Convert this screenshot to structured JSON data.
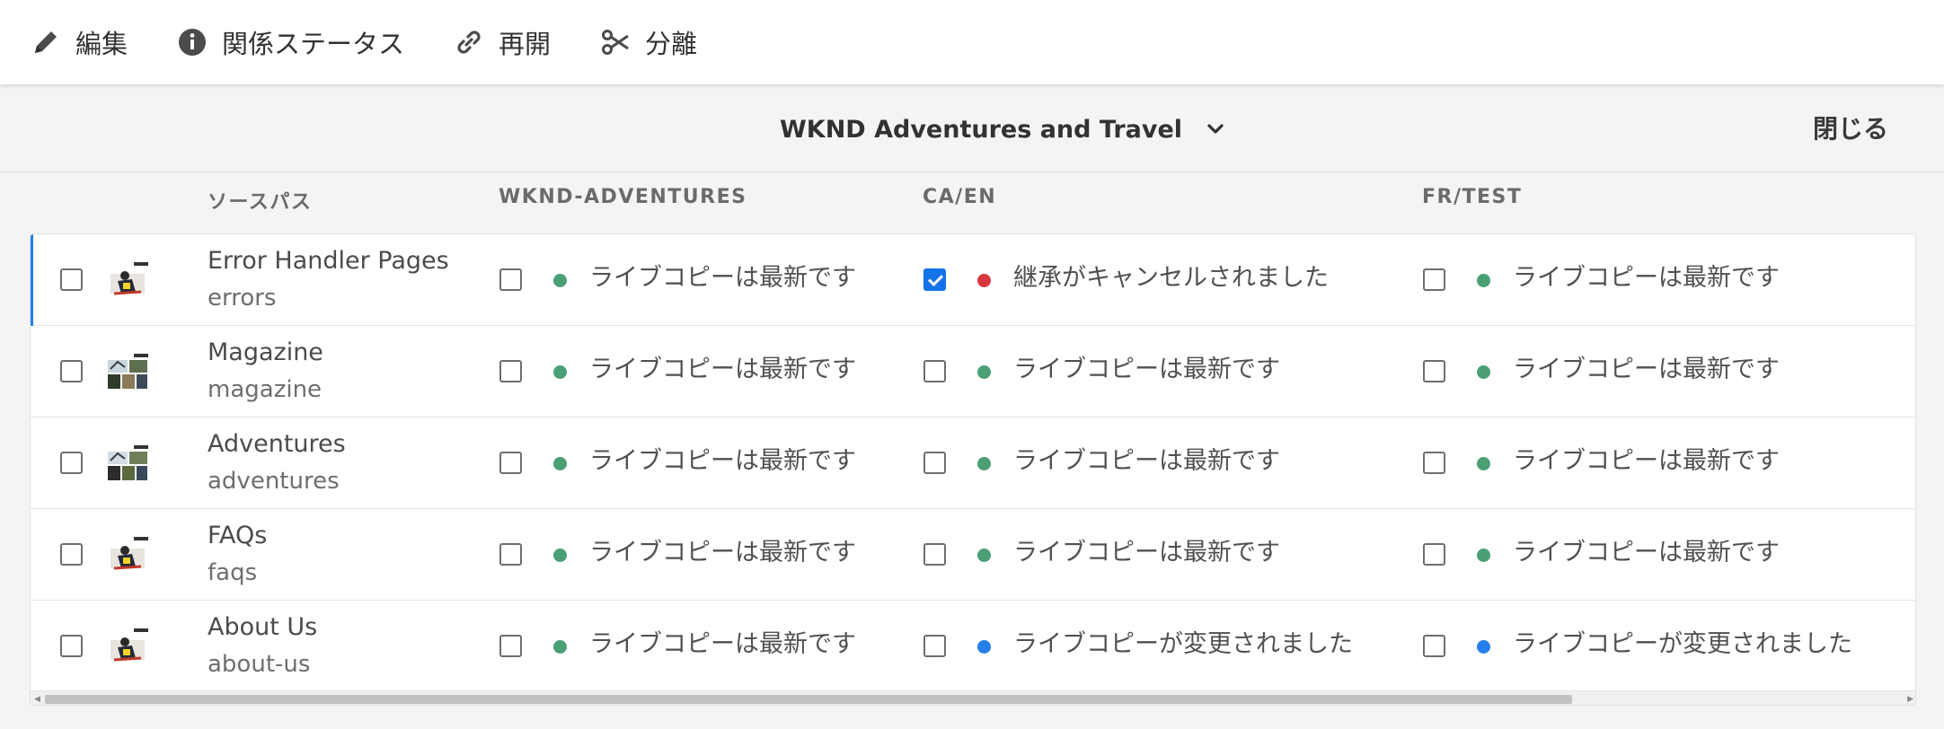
{
  "toolbar": {
    "edit_label": "編集",
    "status_label": "関係ステータス",
    "resume_label": "再開",
    "detach_label": "分離"
  },
  "header": {
    "site_name": "WKND Adventures and Travel",
    "close_label": "閉じる"
  },
  "columns": {
    "source": "ソースパス",
    "c1": "WKND-ADVENTURES",
    "c2": "CA/EN",
    "c3": "FR/TEST"
  },
  "status_colors": {
    "up_to_date": "#4a9f75",
    "cancelled": "#d7373f",
    "modified": "#2680eb"
  },
  "rows": [
    {
      "title": "Error Handler Pages",
      "path": "errors",
      "selected": true,
      "cells": [
        {
          "checked": false,
          "status": "up_to_date",
          "text": "ライブコピーは最新です"
        },
        {
          "checked": true,
          "status": "cancelled",
          "text": "継承がキャンセルされました"
        },
        {
          "checked": false,
          "status": "up_to_date",
          "text": "ライブコピーは最新です"
        }
      ]
    },
    {
      "title": "Magazine",
      "path": "magazine",
      "selected": false,
      "cells": [
        {
          "checked": false,
          "status": "up_to_date",
          "text": "ライブコピーは最新です"
        },
        {
          "checked": false,
          "status": "up_to_date",
          "text": "ライブコピーは最新です"
        },
        {
          "checked": false,
          "status": "up_to_date",
          "text": "ライブコピーは最新です"
        }
      ]
    },
    {
      "title": "Adventures",
      "path": "adventures",
      "selected": false,
      "cells": [
        {
          "checked": false,
          "status": "up_to_date",
          "text": "ライブコピーは最新です"
        },
        {
          "checked": false,
          "status": "up_to_date",
          "text": "ライブコピーは最新です"
        },
        {
          "checked": false,
          "status": "up_to_date",
          "text": "ライブコピーは最新です"
        }
      ]
    },
    {
      "title": "FAQs",
      "path": "faqs",
      "selected": false,
      "cells": [
        {
          "checked": false,
          "status": "up_to_date",
          "text": "ライブコピーは最新です"
        },
        {
          "checked": false,
          "status": "up_to_date",
          "text": "ライブコピーは最新です"
        },
        {
          "checked": false,
          "status": "up_to_date",
          "text": "ライブコピーは最新です"
        }
      ]
    },
    {
      "title": "About Us",
      "path": "about-us",
      "selected": false,
      "cells": [
        {
          "checked": false,
          "status": "up_to_date",
          "text": "ライブコピーは最新です"
        },
        {
          "checked": false,
          "status": "modified",
          "text": "ライブコピーが変更されました"
        },
        {
          "checked": false,
          "status": "modified",
          "text": "ライブコピーが変更されました"
        }
      ]
    }
  ]
}
